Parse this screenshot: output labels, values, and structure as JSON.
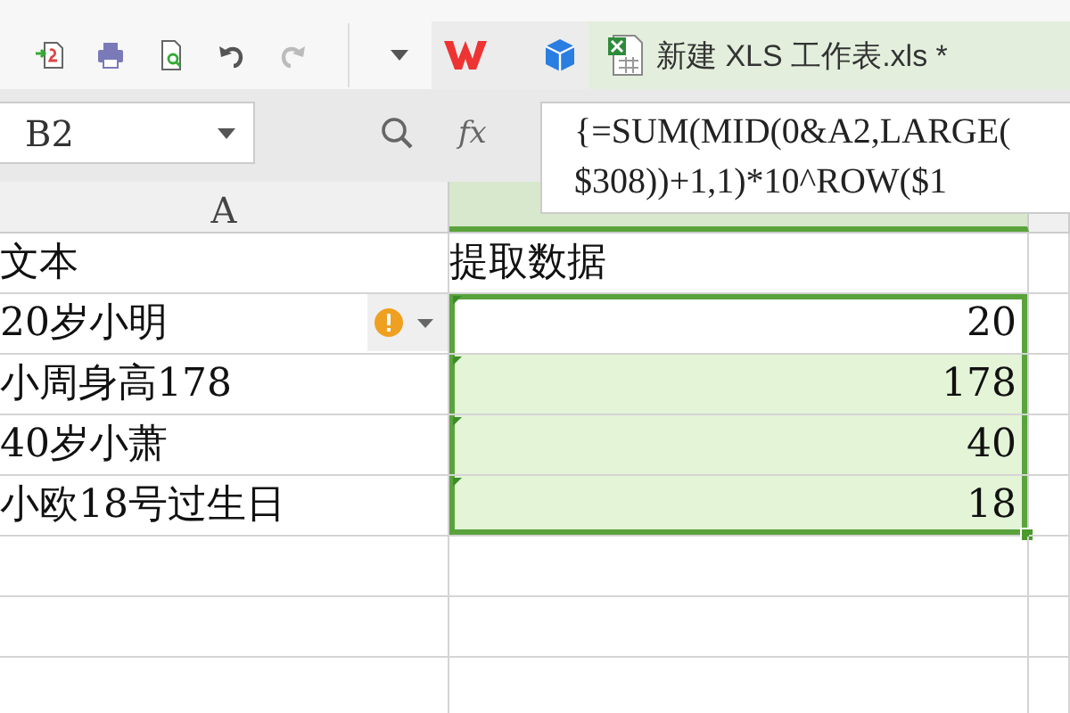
{
  "toolbar": {
    "buttons": [
      {
        "kind": "export"
      },
      {
        "kind": "print"
      },
      {
        "kind": "preview"
      },
      {
        "kind": "undo",
        "disabled": false
      },
      {
        "kind": "redo",
        "disabled": true
      },
      {
        "kind": "more"
      }
    ],
    "tabs": [
      {
        "kind": "app",
        "selected": false
      },
      {
        "kind": "cube",
        "selected": false
      },
      {
        "kind": "sheet",
        "title": "新建 XLS 工作表.xls *",
        "selected": true
      }
    ]
  },
  "formula_bar": {
    "name_box": "B2",
    "function_label": "fx",
    "formula_lines": [
      "{=SUM(MID(0&A2,LARGE(",
      "$308))+1,1)*10^ROW($1"
    ]
  },
  "sheet": {
    "columns": [
      {
        "label": "A",
        "selected": false
      },
      {
        "selected": true
      },
      {
        "selected": false
      }
    ],
    "rows": [
      {
        "kind": "header",
        "cells": [
          "文本",
          "提取数据"
        ],
        "selected": false,
        "active": false,
        "warning": false,
        "text_marker": false
      },
      {
        "kind": "data",
        "cells": [
          "20岁小明",
          "20"
        ],
        "selected": true,
        "active": true,
        "warning": true,
        "text_marker": true
      },
      {
        "kind": "data",
        "cells": [
          "小周身高178",
          "178"
        ],
        "selected": true,
        "active": false,
        "warning": false,
        "text_marker": true
      },
      {
        "kind": "data",
        "cells": [
          "40岁小萧",
          "40"
        ],
        "selected": true,
        "active": false,
        "warning": false,
        "text_marker": true
      },
      {
        "kind": "data",
        "cells": [
          "小欧18号过生日",
          "18"
        ],
        "selected": true,
        "active": false,
        "warning": false,
        "text_marker": true
      }
    ]
  }
}
